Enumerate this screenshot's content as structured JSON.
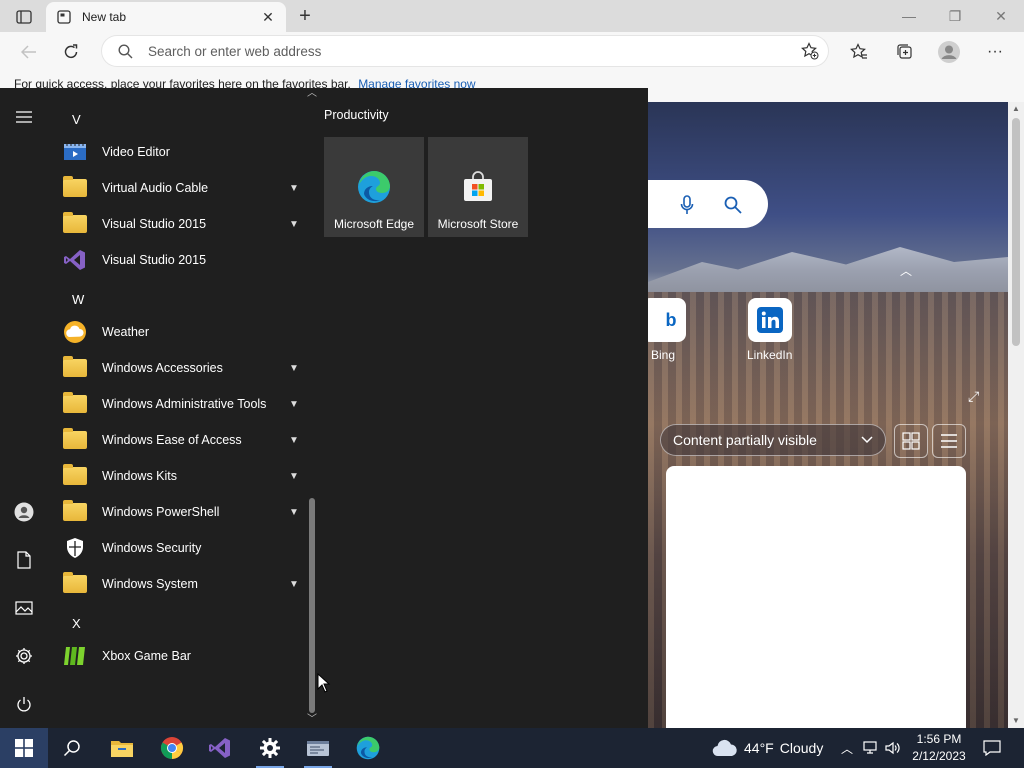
{
  "browser": {
    "tab_title": "New tab",
    "address_placeholder": "Search or enter web address",
    "favorites_bar_text": "For quick access, place your favorites here on the favorites bar.",
    "favorites_bar_link": "Manage favorites now"
  },
  "newtab_page": {
    "quick_links": [
      "Bing",
      "LinkedIn"
    ],
    "content_dropdown": "Content partially visible"
  },
  "start_menu": {
    "apps": [
      {
        "type": "letter",
        "label": "V"
      },
      {
        "type": "app",
        "label": "Video Editor",
        "icon": "video-editor-icon"
      },
      {
        "type": "folder",
        "label": "Virtual Audio Cable"
      },
      {
        "type": "folder",
        "label": "Visual Studio 2015"
      },
      {
        "type": "app",
        "label": "Visual Studio 2015",
        "icon": "visual-studio-icon"
      },
      {
        "type": "letter",
        "label": "W"
      },
      {
        "type": "app",
        "label": "Weather",
        "icon": "weather-icon"
      },
      {
        "type": "folder",
        "label": "Windows Accessories"
      },
      {
        "type": "folder",
        "label": "Windows Administrative Tools"
      },
      {
        "type": "folder",
        "label": "Windows Ease of Access"
      },
      {
        "type": "folder",
        "label": "Windows Kits"
      },
      {
        "type": "folder",
        "label": "Windows PowerShell"
      },
      {
        "type": "app",
        "label": "Windows Security",
        "icon": "windows-security-icon"
      },
      {
        "type": "folder",
        "label": "Windows System"
      },
      {
        "type": "letter",
        "label": "X"
      },
      {
        "type": "app",
        "label": "Xbox Game Bar",
        "icon": "xbox-game-bar-icon"
      }
    ],
    "tile_group": "Productivity",
    "tiles": [
      {
        "label": "Microsoft Edge",
        "icon": "edge-icon"
      },
      {
        "label": "Microsoft Store",
        "icon": "store-icon"
      }
    ]
  },
  "taskbar": {
    "weather_temp": "44°F",
    "weather_desc": "Cloudy",
    "time": "1:56 PM",
    "date": "2/12/2023"
  },
  "colors": {
    "start_bg": "#1f1f1f",
    "taskbar_bg": "#1c2433",
    "folder_yellow": "#e8b73a",
    "link_blue": "#1a5fb4"
  }
}
